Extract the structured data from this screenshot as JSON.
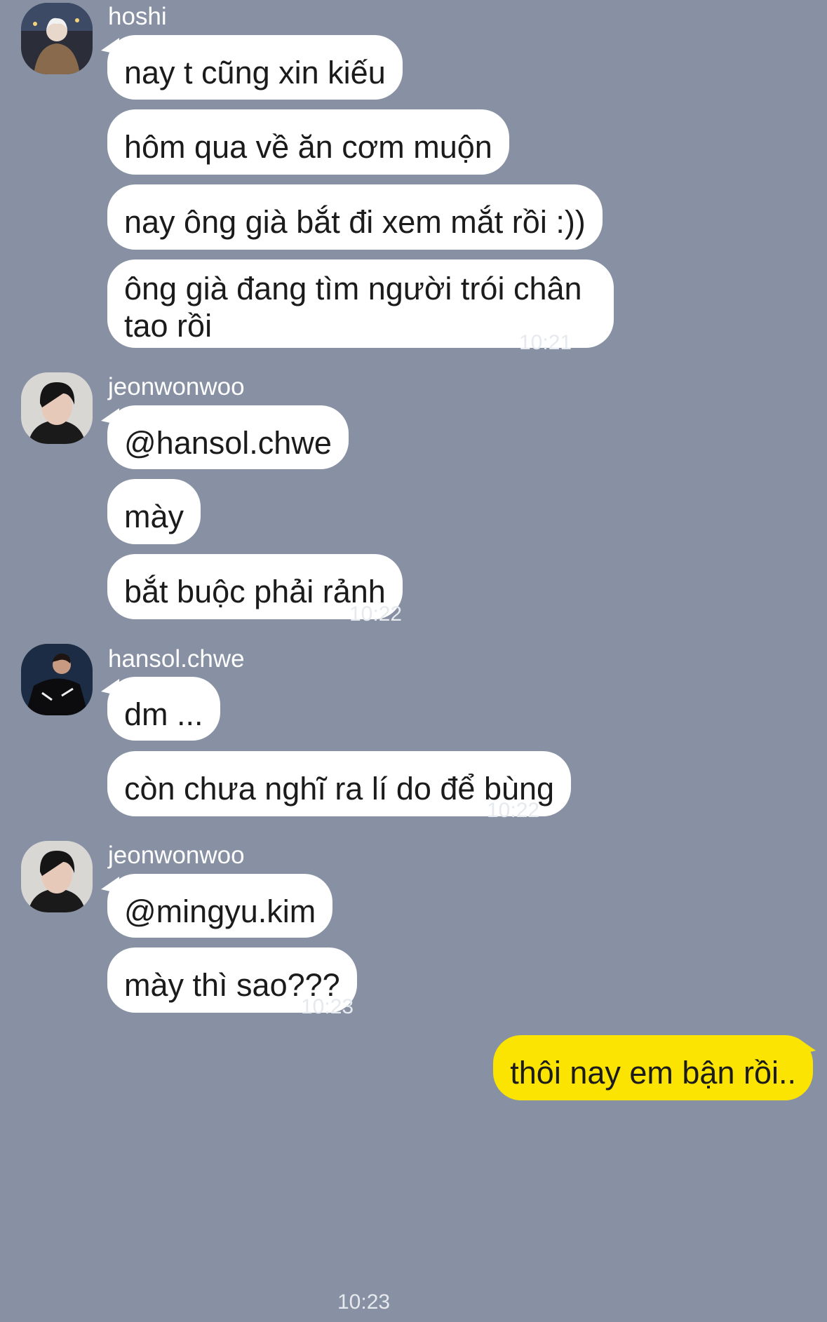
{
  "groups": [
    {
      "sender": "hoshi",
      "avatar_icon": "user-avatar-icon",
      "messages": [
        "nay t cũng xin kiếu",
        "hôm qua về ăn cơm muộn",
        "nay ông già bắt đi xem mắt rồi :))",
        "ông già đang tìm người trói chân tao rồi"
      ],
      "time": "10:21"
    },
    {
      "sender": "jeonwonwoo",
      "avatar_icon": "user-avatar-icon",
      "messages": [
        "@hansol.chwe",
        "mày",
        "bắt buộc phải rảnh"
      ],
      "time": "10:22"
    },
    {
      "sender": "hansol.chwe",
      "avatar_icon": "user-avatar-icon",
      "messages": [
        "dm ...",
        "còn chưa nghĩ ra lí do để bùng"
      ],
      "time": "10:22"
    },
    {
      "sender": "jeonwonwoo",
      "avatar_icon": "user-avatar-icon",
      "messages": [
        "@mingyu.kim",
        "mày thì sao???"
      ],
      "time": "10:23"
    }
  ],
  "outgoing": {
    "message": "thôi nay em bận rồi..",
    "time": "10:23"
  },
  "colors": {
    "background": "#8791a3",
    "incoming_bubble": "#ffffff",
    "outgoing_bubble": "#fbe402"
  }
}
